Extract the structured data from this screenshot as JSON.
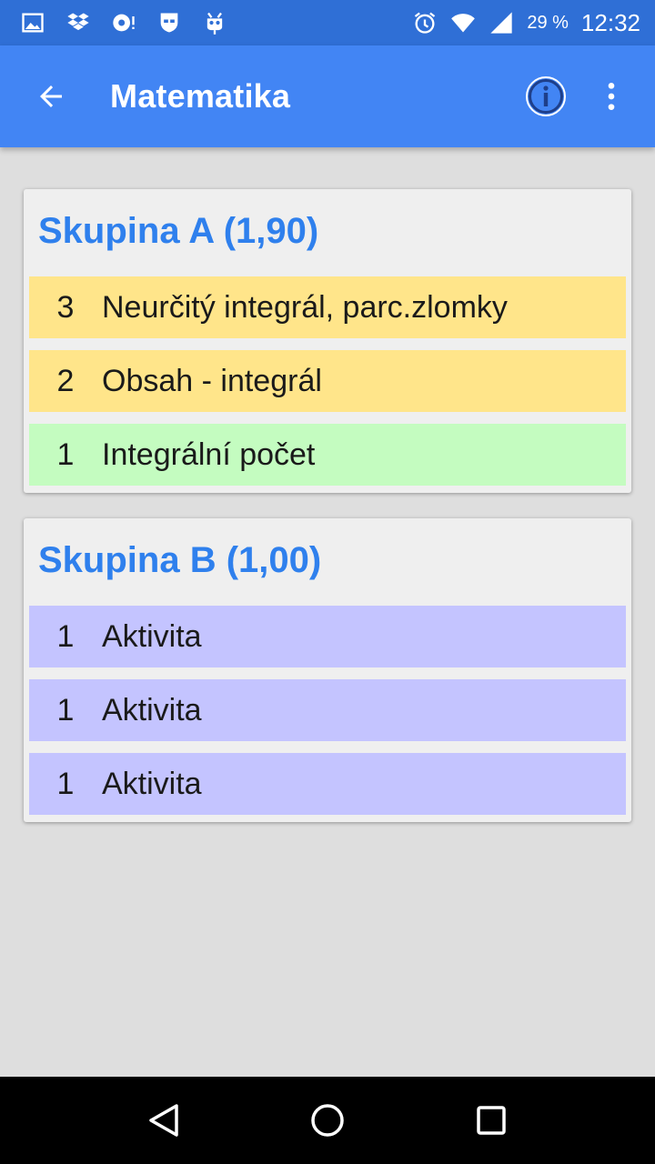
{
  "status_bar": {
    "icons_left": [
      "image-icon",
      "dropbox-icon",
      "sync-icon",
      "shield-face-icon",
      "android-icon"
    ],
    "icons_right": [
      "alarm-icon",
      "wifi-icon",
      "signal-icon"
    ],
    "battery": "29 %",
    "time": "12:32"
  },
  "app_bar": {
    "title": "Matematika",
    "back_icon": "arrow-left-icon",
    "info_icon": "info-icon",
    "more_icon": "more-vert-icon"
  },
  "groups": [
    {
      "title": "Skupina A (1,90)",
      "items": [
        {
          "grade": "3",
          "label": "Neurčitý integrál, parc.zlomky",
          "color": "#ffe58a"
        },
        {
          "grade": "2",
          "label": "Obsah - integrál",
          "color": "#ffe58a"
        },
        {
          "grade": "1",
          "label": "Integrální počet",
          "color": "#c4fcc0"
        }
      ]
    },
    {
      "title": "Skupina B (1,00)",
      "items": [
        {
          "grade": "1",
          "label": "Aktivita",
          "color": "#c4c4ff"
        },
        {
          "grade": "1",
          "label": "Aktivita",
          "color": "#c4c4ff"
        },
        {
          "grade": "1",
          "label": "Aktivita",
          "color": "#c4c4ff"
        }
      ]
    }
  ],
  "colors": {
    "status_bar": "#2f6fd6",
    "app_bar": "#4285f4",
    "group_title": "#2f80ed",
    "background": "#dedede"
  },
  "nav_bar": {
    "icons": [
      "back-triangle-icon",
      "home-circle-icon",
      "recents-square-icon"
    ]
  }
}
